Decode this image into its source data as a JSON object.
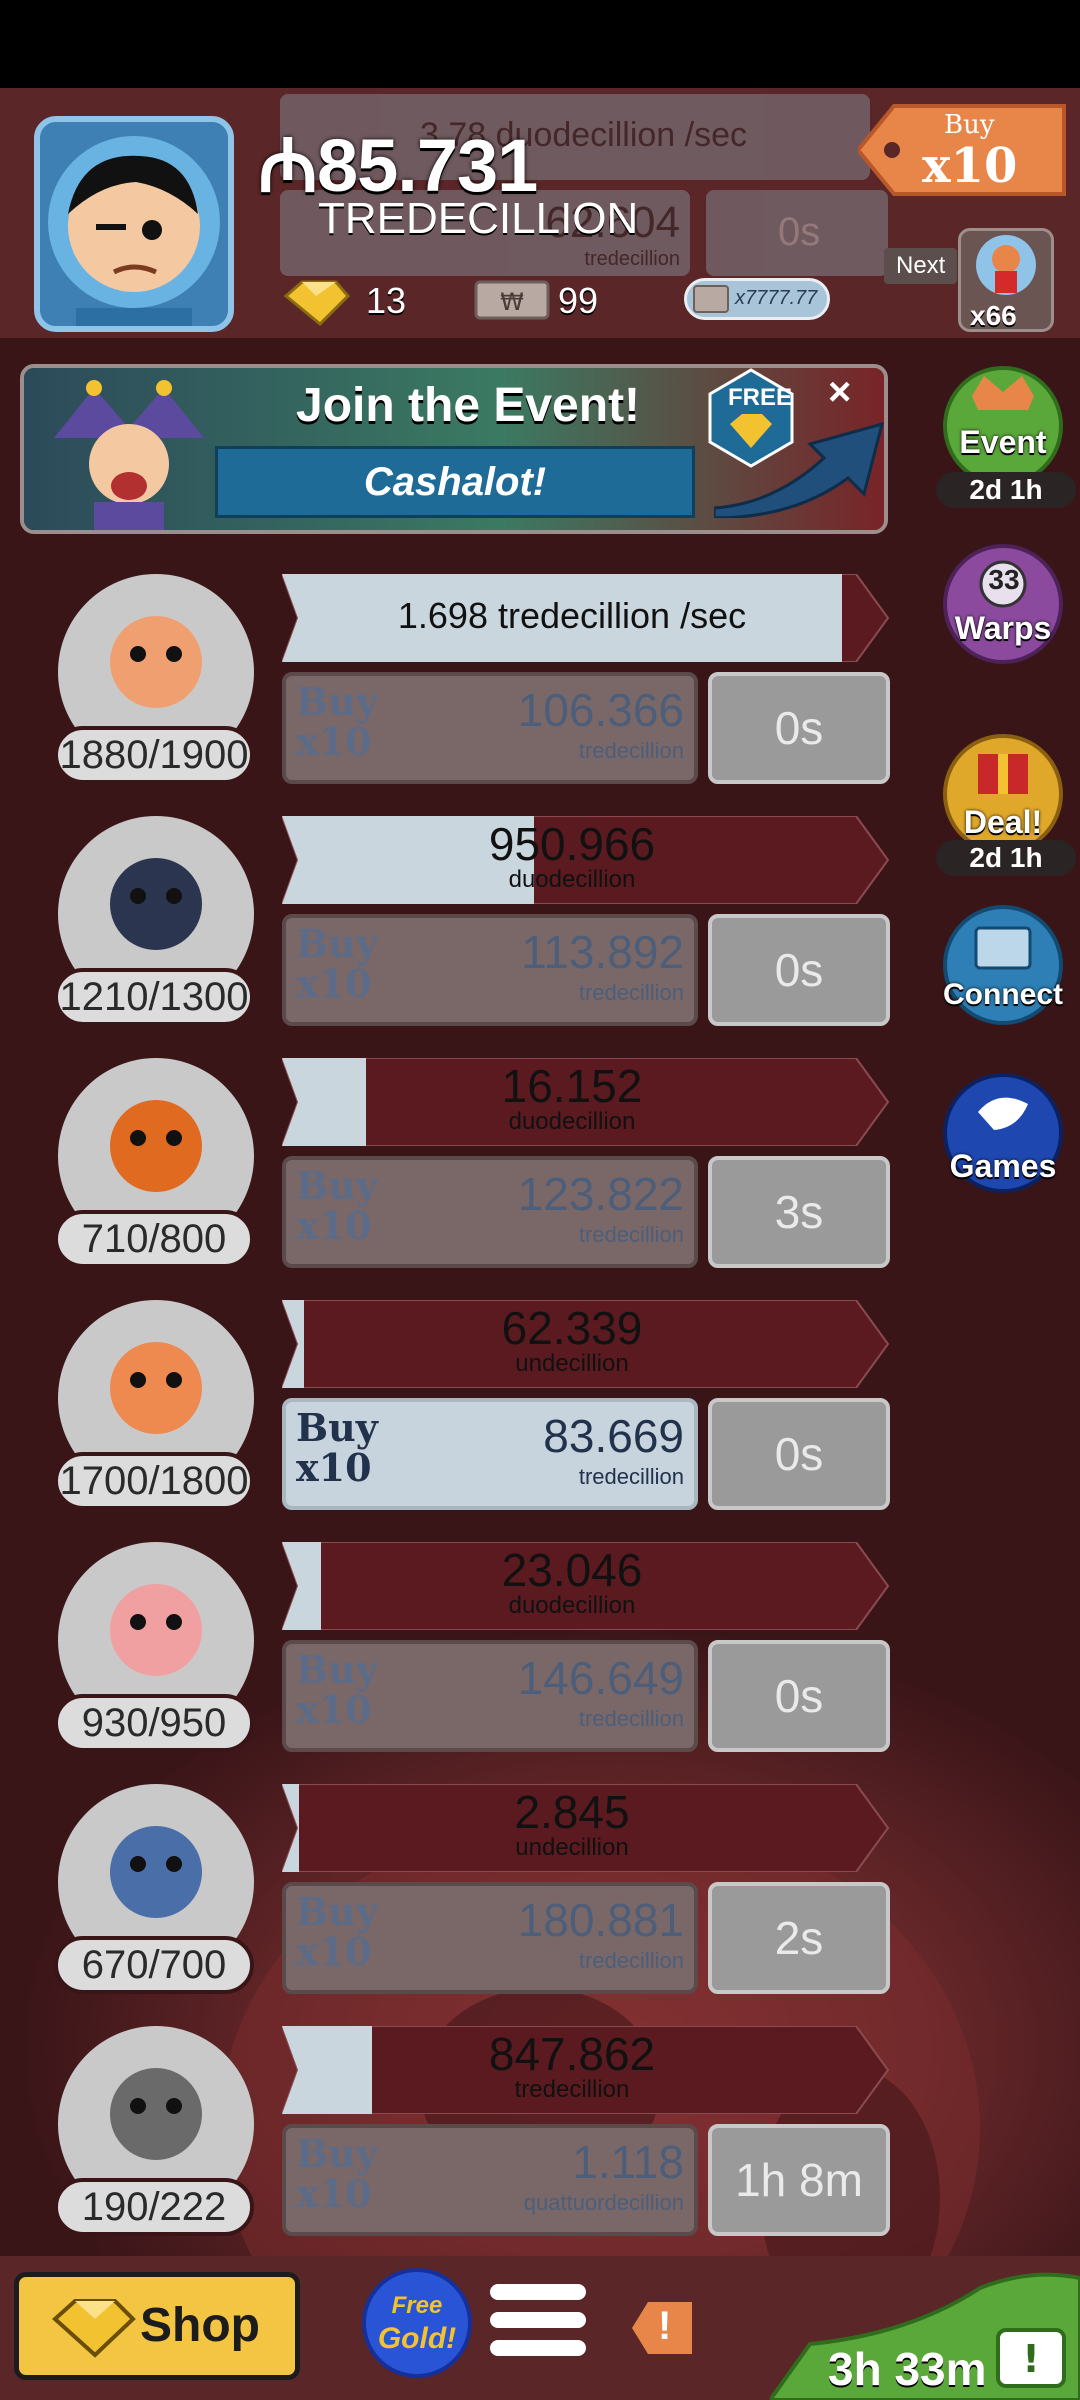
{
  "header": {
    "money_symbol": "₼",
    "money_value": "85.731",
    "money_unit": "TREDECILLION",
    "gold": "13",
    "megabucks": "99",
    "ticket_text": "x7777.77",
    "buy_multiplier_top": "Buy",
    "buy_multiplier": "x10",
    "next_label": "Next",
    "next_count": "x66",
    "ghost_rate": "3.78 duodecillion /sec",
    "ghost_cost": "62.604",
    "ghost_cost_unit": "tredecillion",
    "ghost_timer": "0s"
  },
  "event_banner": {
    "title": "Join the Event!",
    "subtitle": "Cashalot!",
    "free_label": "FREE",
    "close": "×"
  },
  "side_menu": [
    {
      "label": "Event",
      "sub": "2d 1h",
      "color": "#5aa83a"
    },
    {
      "label": "Warps",
      "badge": "33",
      "color": "#8b4a9e"
    },
    {
      "label": "Deal!",
      "sub": "2d 1h",
      "color": "#e0a82a"
    },
    {
      "label": "Connect",
      "color": "#2d7fb5"
    },
    {
      "label": "Games",
      "color": "#1e47b0"
    }
  ],
  "businesses": [
    {
      "level": "1880/1900",
      "progress_value": "1.698 tredecillion /sec",
      "progress_unit": "",
      "fill": 1.0,
      "buy_label": "Buy",
      "buy_mult": "x10",
      "cost": "106.366",
      "cost_unit": "tredecillion",
      "timer": "0s",
      "affordable": false
    },
    {
      "level": "1210/1300",
      "progress_value": "950.966",
      "progress_unit": "duodecillion",
      "fill": 0.45,
      "buy_label": "Buy",
      "buy_mult": "x10",
      "cost": "113.892",
      "cost_unit": "tredecillion",
      "timer": "0s",
      "affordable": false
    },
    {
      "level": "710/800",
      "progress_value": "16.152",
      "progress_unit": "duodecillion",
      "fill": 0.15,
      "buy_label": "Buy",
      "buy_mult": "x10",
      "cost": "123.822",
      "cost_unit": "tredecillion",
      "timer": "3s",
      "affordable": false
    },
    {
      "level": "1700/1800",
      "progress_value": "62.339",
      "progress_unit": "undecillion",
      "fill": 0.04,
      "buy_label": "Buy",
      "buy_mult": "x10",
      "cost": "83.669",
      "cost_unit": "tredecillion",
      "timer": "0s",
      "affordable": true
    },
    {
      "level": "930/950",
      "progress_value": "23.046",
      "progress_unit": "duodecillion",
      "fill": 0.07,
      "buy_label": "Buy",
      "buy_mult": "x10",
      "cost": "146.649",
      "cost_unit": "tredecillion",
      "timer": "0s",
      "affordable": false
    },
    {
      "level": "670/700",
      "progress_value": "2.845",
      "progress_unit": "undecillion",
      "fill": 0.03,
      "buy_label": "Buy",
      "buy_mult": "x10",
      "cost": "180.881",
      "cost_unit": "tredecillion",
      "timer": "2s",
      "affordable": false
    },
    {
      "level": "190/222",
      "progress_value": "847.862",
      "progress_unit": "tredecillion",
      "fill": 0.16,
      "buy_label": "Buy",
      "buy_mult": "x10",
      "cost": "1.118",
      "cost_unit": "quattuordecillion",
      "timer": "1h 8m",
      "affordable": false
    }
  ],
  "bottom_bar": {
    "shop": "Shop",
    "free_gold_line1": "Free",
    "free_gold_line2": "Gold!",
    "alert": "!",
    "tv_timer": "3h 33m"
  },
  "colors": {
    "background": "#3a1518",
    "header": "#5a2627",
    "progress_fill": "#c9d6de",
    "progress_empty": "#5a1a20",
    "shop_yellow": "#f4c542"
  }
}
